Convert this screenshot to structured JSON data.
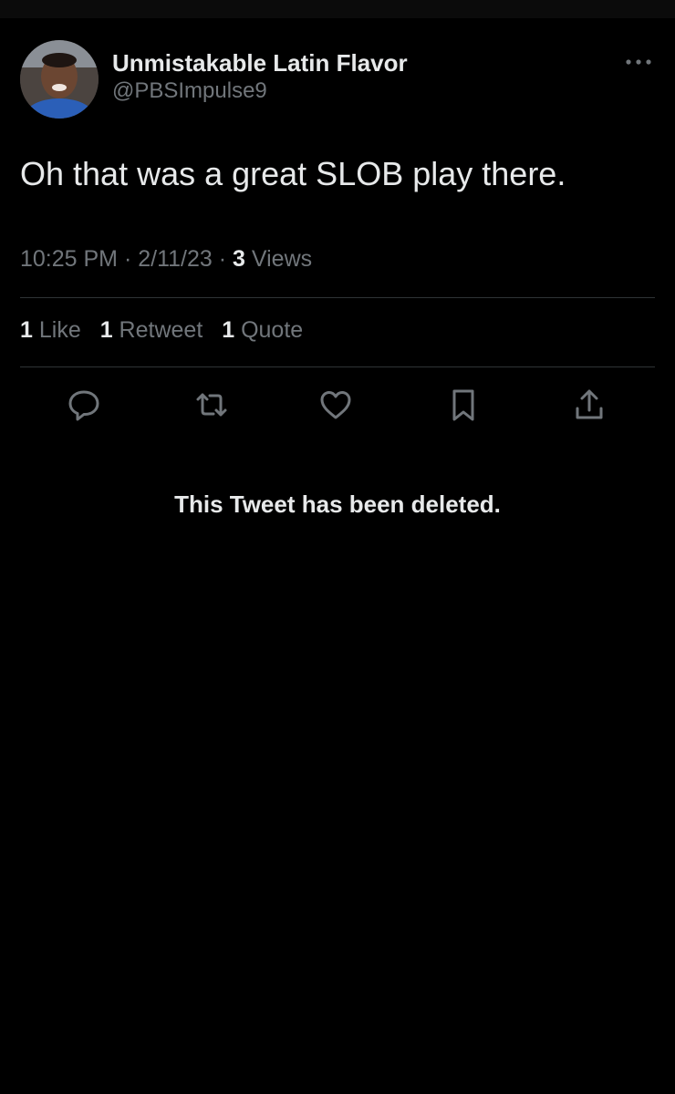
{
  "tweet": {
    "author": {
      "display_name": "Unmistakable Latin Flavor",
      "handle": "@PBSImpulse9"
    },
    "text": "Oh that was a great SLOB play there.",
    "time": "10:25 PM",
    "date": "2/11/23",
    "separator": "·",
    "views_count": "3",
    "views_label": "Views"
  },
  "stats": {
    "likes": {
      "count": "1",
      "label": "Like"
    },
    "retweets": {
      "count": "1",
      "label": "Retweet"
    },
    "quotes": {
      "count": "1",
      "label": "Quote"
    }
  },
  "actions": [
    "reply-icon",
    "retweet-icon",
    "like-icon",
    "bookmark-icon",
    "share-icon"
  ],
  "notice": "This Tweet has been deleted.",
  "colors": {
    "background": "#000000",
    "primary_text": "#e7e9ea",
    "secondary_text": "#71767b",
    "divider": "#2f3336"
  }
}
